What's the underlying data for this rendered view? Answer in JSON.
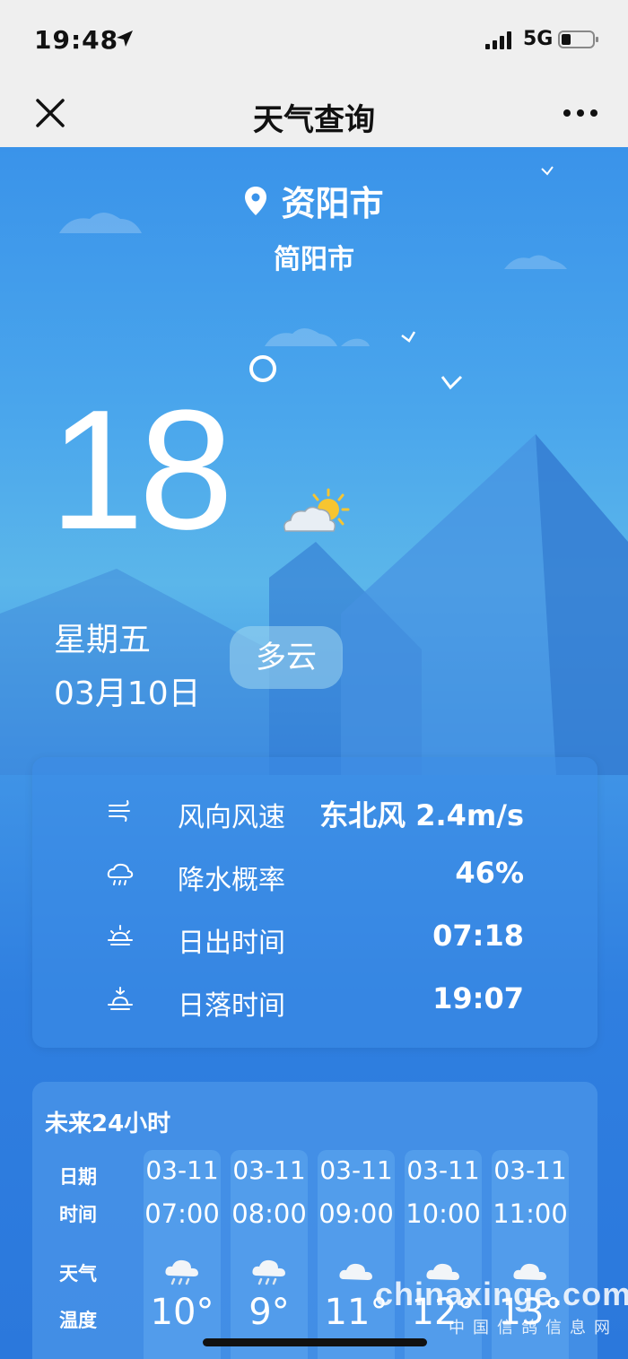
{
  "status_bar": {
    "time": "19:48",
    "network": "5G",
    "icons": [
      "location-arrow-icon",
      "signal-icon",
      "battery-icon"
    ]
  },
  "nav": {
    "title": "天气查询",
    "close_icon": "close-icon",
    "more_icon": "more-icon"
  },
  "location": {
    "city": "资阳市",
    "district": "简阳市"
  },
  "current": {
    "temperature": "18",
    "weekday": "星期五",
    "date": "03月10日",
    "condition": "多云",
    "condition_icon": "cloud-sun-icon"
  },
  "details": [
    {
      "icon": "wind-icon",
      "label": "风向风速",
      "value": "东北风 2.4m/s"
    },
    {
      "icon": "rain-cloud-icon",
      "label": "降水概率",
      "value": "46%"
    },
    {
      "icon": "sunrise-icon",
      "label": "日出时间",
      "value": "07:18"
    },
    {
      "icon": "sunset-icon",
      "label": "日落时间",
      "value": "19:07"
    }
  ],
  "forecast": {
    "title": "未来24小时",
    "row_labels": {
      "date": "日期",
      "time": "时间",
      "weather": "天气",
      "temp": "温度"
    },
    "hours": [
      {
        "date": "03-11",
        "time": "07:00",
        "icon": "rain-cloud-icon",
        "temp": "10°"
      },
      {
        "date": "03-11",
        "time": "08:00",
        "icon": "rain-cloud-icon",
        "temp": "9°"
      },
      {
        "date": "03-11",
        "time": "09:00",
        "icon": "cloud-icon",
        "temp": "11°"
      },
      {
        "date": "03-11",
        "time": "10:00",
        "icon": "cloud-icon",
        "temp": "12°"
      },
      {
        "date": "03-11",
        "time": "11:00",
        "icon": "cloud-icon",
        "temp": "13°"
      }
    ]
  },
  "watermark": {
    "main": "chinaxinge.com",
    "sub": "中国信鸽信息网"
  },
  "colors": {
    "sky_top": "#3a93ea",
    "sky_mid": "#5bb6ea",
    "sky_bottom": "#2b78dc",
    "text": "#ffffff",
    "status_bg": "#efefef"
  }
}
